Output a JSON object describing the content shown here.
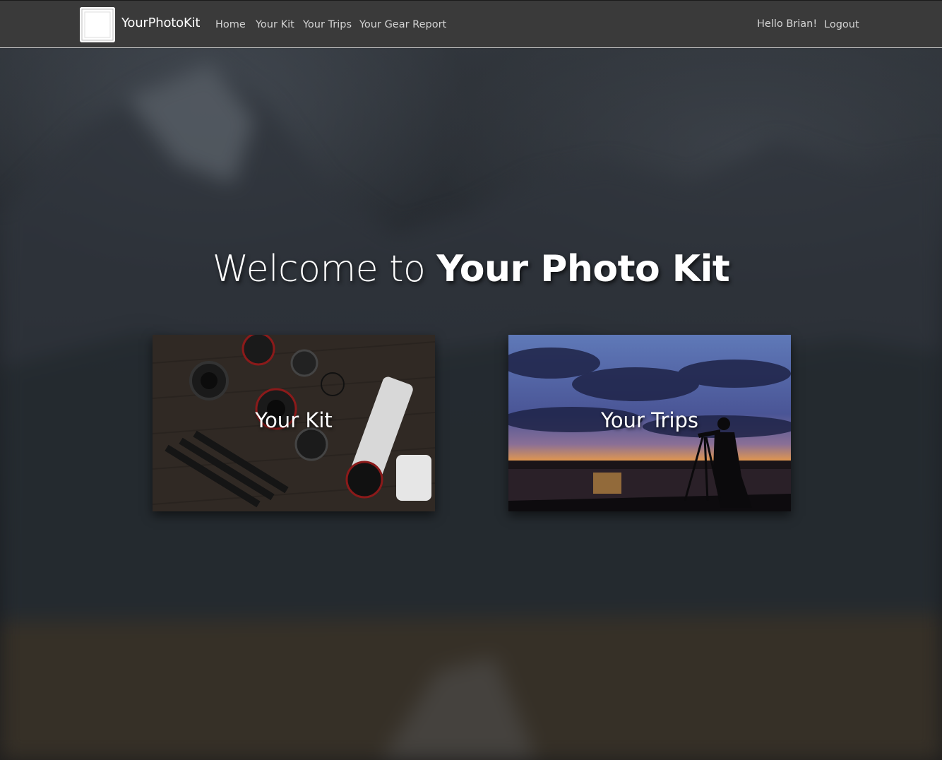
{
  "navbar": {
    "brand": "YourPhotoKit",
    "links": [
      "Home",
      "Your Kit",
      "Your Trips",
      "Your Gear Report"
    ],
    "greeting": "Hello Brian!",
    "logout": "Logout"
  },
  "hero": {
    "welcome_prefix": "Welcome to ",
    "welcome_emphasis": "Your Photo Kit"
  },
  "cards": [
    {
      "label": "Your Kit"
    },
    {
      "label": "Your Trips"
    }
  ],
  "colors": {
    "navbar_bg": "#3a3a3a",
    "text": "#ffffff",
    "nav_text": "#d4d4d4"
  }
}
